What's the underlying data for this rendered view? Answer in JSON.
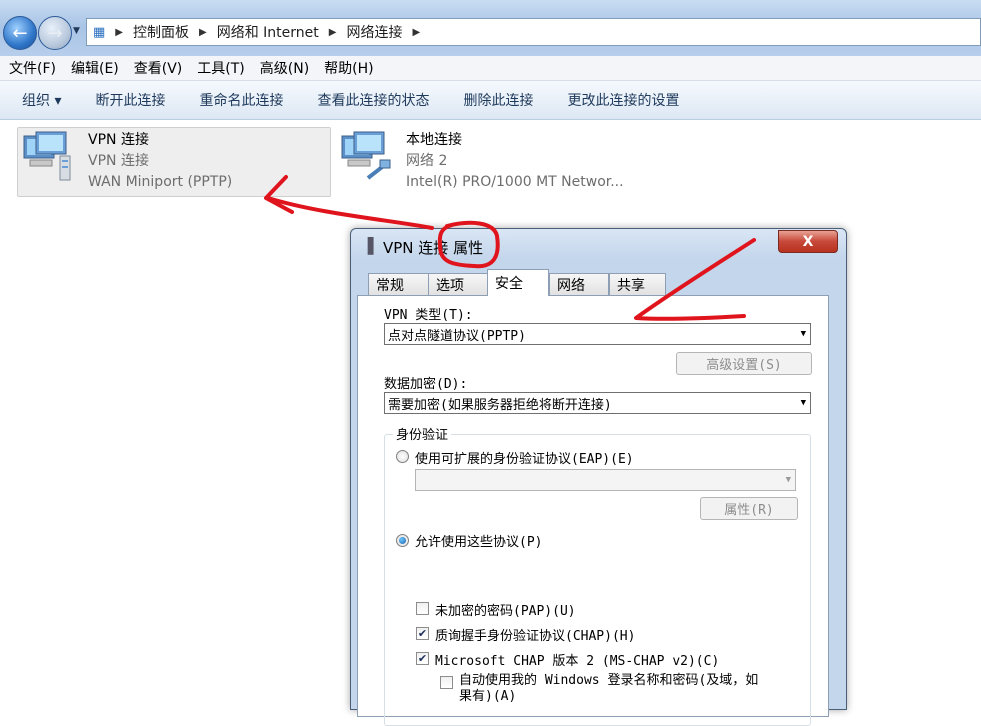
{
  "breadcrumb": [
    "控制面板",
    "网络和 Internet",
    "网络连接"
  ],
  "menubar": [
    "文件(F)",
    "编辑(E)",
    "查看(V)",
    "工具(T)",
    "高级(N)",
    "帮助(H)"
  ],
  "commandbar": [
    "组织 ▾",
    "断开此连接",
    "重命名此连接",
    "查看此连接的状态",
    "删除此连接",
    "更改此连接的设置"
  ],
  "connections": [
    {
      "name": "VPN 连接",
      "status": "VPN 连接",
      "device": "WAN Miniport (PPTP)"
    },
    {
      "name": "本地连接",
      "status": "网络  2",
      "device": "Intel(R) PRO/1000 MT Networ..."
    }
  ],
  "dialog": {
    "title": "VPN 连接 属性",
    "close": "X",
    "tabs": [
      "常规",
      "选项",
      "安全",
      "网络",
      "共享"
    ],
    "active_tab": "安全",
    "vpn_type_label": "VPN 类型(T):",
    "vpn_type_value": "点对点隧道协议(PPTP)",
    "advanced_button": "高级设置(S)",
    "encryption_label": "数据加密(D):",
    "encryption_value": "需要加密(如果服务器拒绝将断开连接)",
    "auth_group_label": "身份验证",
    "eap_radio": "使用可扩展的身份验证协议(EAP)(E)",
    "eap_properties_button": "属性(R)",
    "allow_radio": "允许使用这些协议(P)",
    "pap_checkbox": "未加密的密码(PAP)(U)",
    "chap_checkbox": "质询握手身份验证协议(CHAP)(H)",
    "mschap_checkbox": "Microsoft CHAP 版本 2 (MS-CHAP v2)(C)",
    "auto_windows_line1": "自动使用我的 Windows 登录名称和密码(及域，如",
    "auto_windows_line2": "果有)(A)"
  },
  "colors": {
    "annotation": "#e0141c",
    "accent": "#1e395b"
  }
}
